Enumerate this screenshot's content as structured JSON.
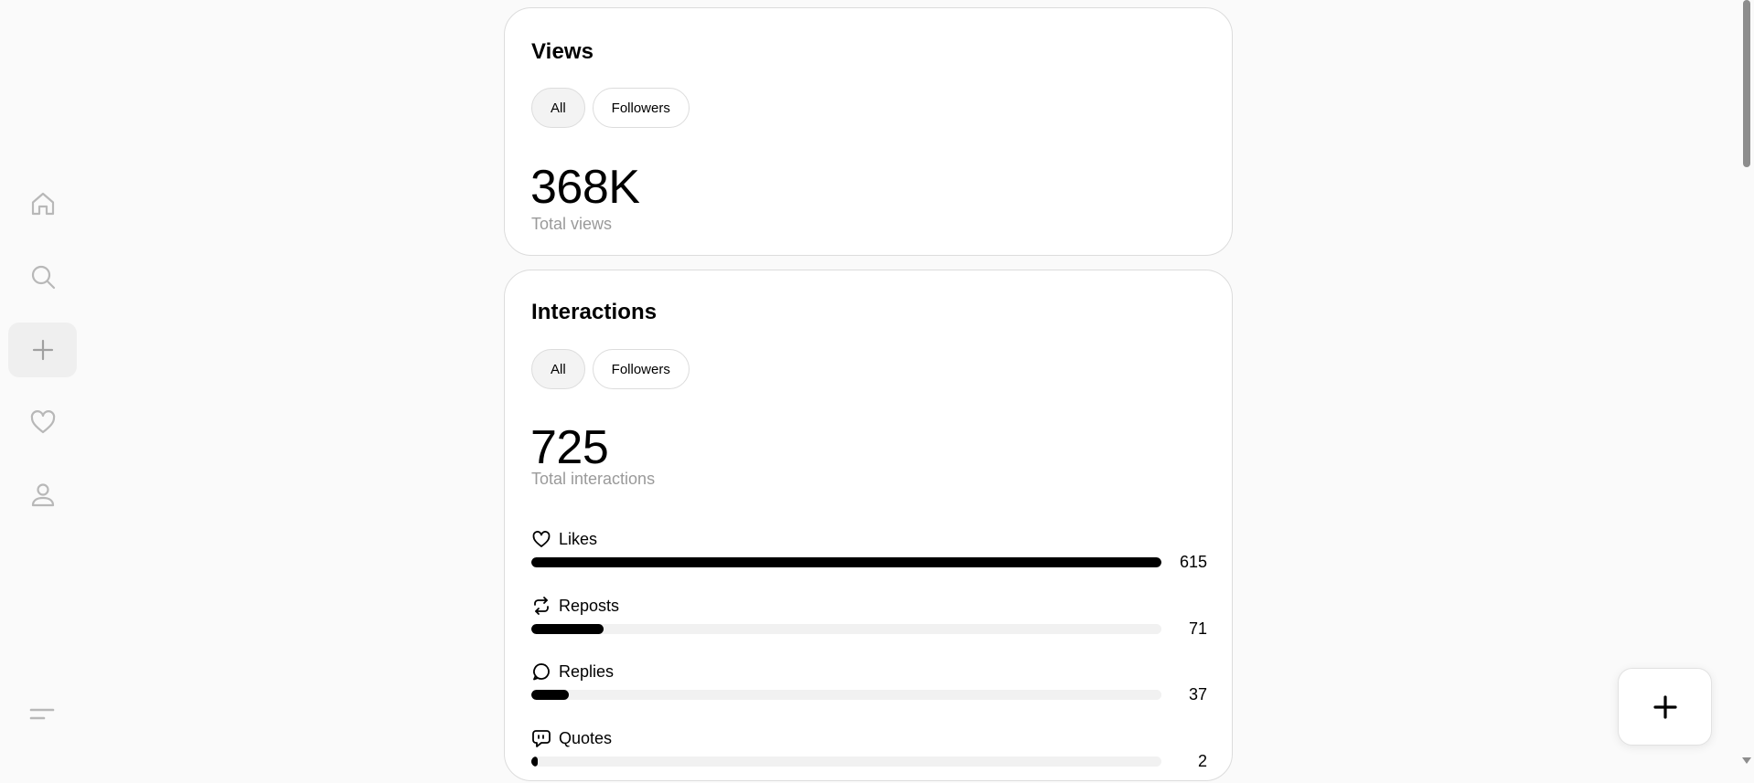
{
  "nav": {
    "items": [
      {
        "icon": "home-icon"
      },
      {
        "icon": "search-icon"
      },
      {
        "icon": "plus-icon",
        "active": true
      },
      {
        "icon": "heart-icon"
      },
      {
        "icon": "user-icon"
      }
    ],
    "menu_icon": "menu-icon"
  },
  "views": {
    "title": "Views",
    "filters": [
      "All",
      "Followers"
    ],
    "selected_filter": "All",
    "total": "368K",
    "total_label": "Total views"
  },
  "interactions": {
    "title": "Interactions",
    "filters": [
      "All",
      "Followers"
    ],
    "selected_filter": "All",
    "total": "725",
    "total_label": "Total interactions",
    "metrics": [
      {
        "label": "Likes",
        "icon": "heart-icon",
        "value": "615",
        "fraction": 1.0
      },
      {
        "label": "Reposts",
        "icon": "repost-icon",
        "value": "71",
        "fraction": 0.115
      },
      {
        "label": "Replies",
        "icon": "reply-icon",
        "value": "37",
        "fraction": 0.06
      },
      {
        "label": "Quotes",
        "icon": "quote-icon",
        "value": "2",
        "fraction": 0.008
      }
    ]
  },
  "fab": {
    "icon": "plus-icon"
  },
  "colors": {
    "accent": "#000000",
    "muted_text": "#9a9a9a",
    "track": "#f1f1f1",
    "background": "#fafafa"
  }
}
